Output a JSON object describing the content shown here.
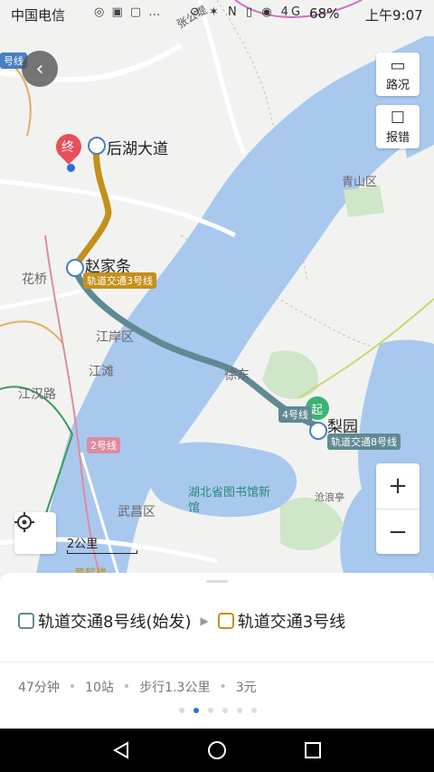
{
  "statusbar": {
    "carrier": "中国电信",
    "battery": "68%",
    "time": "上午9:07"
  },
  "map": {
    "labels": {
      "end_station": "后湖大道",
      "zhaojiatiao": "赵家条",
      "huaqiao": "花桥",
      "jiangan": "江岸区",
      "jiangtan": "江滩",
      "jianghanlu": "江汉路",
      "xudong": "徐东",
      "liyuan": "梨园",
      "qingshan": "青山区",
      "wuchang": "武昌区",
      "library": "湖北省图书馆新馆",
      "canglangting": "沧浪亭",
      "zhangongdi": "张公堤",
      "huanghelou": "黄鹤楼"
    },
    "badges": {
      "line3": "轨道交通3号线",
      "line8": "轨道交通8号线",
      "line4": "4号线",
      "line2": "2号线",
      "line_small": "号线"
    },
    "pins": {
      "end": "终",
      "start": "起"
    },
    "controls": {
      "traffic": "路况",
      "report": "报错",
      "zoom_in": "+",
      "zoom_out": "−",
      "scale": "2公里"
    },
    "colors": {
      "line8": "#5f8a94",
      "line3": "#c4901a",
      "water": "#a9c8ee"
    }
  },
  "panel": {
    "route": {
      "segment1": "轨道交通8号线(始发)",
      "segment2": "轨道交通3号线"
    },
    "summary": {
      "duration": "47分钟",
      "stops": "10站",
      "walk": "步行1.3公里",
      "price": "3元"
    },
    "pages": {
      "count": 6,
      "active": 1
    }
  }
}
